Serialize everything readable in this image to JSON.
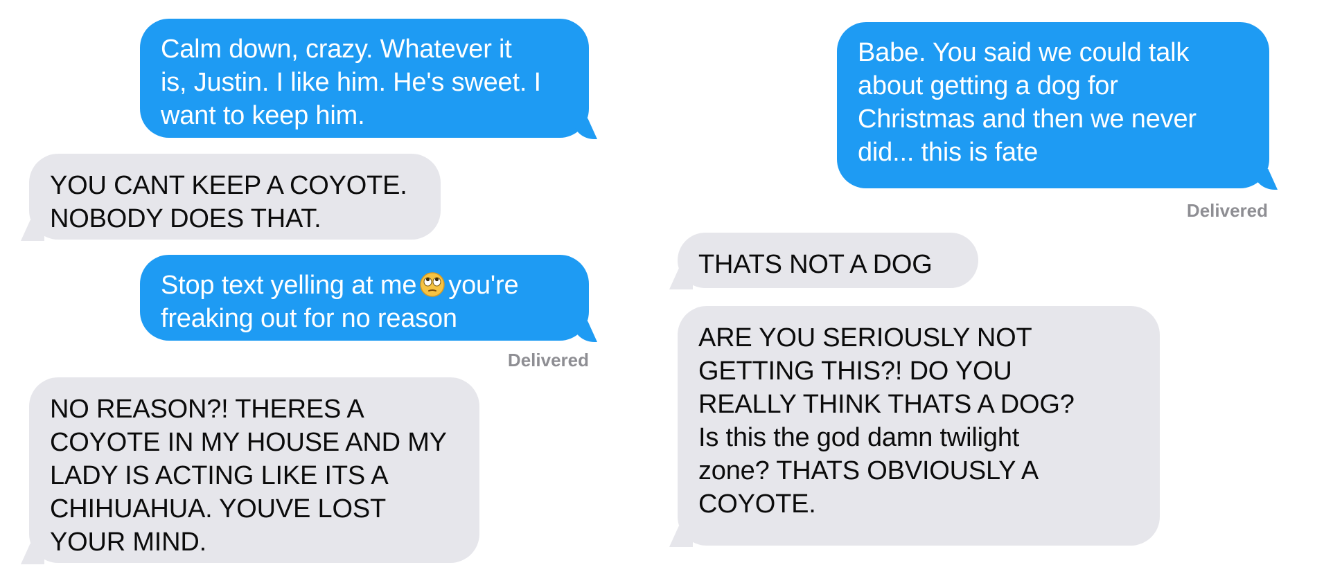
{
  "left_conversation": {
    "messages": [
      {
        "side": "sent",
        "text": "Calm down, crazy. Whatever it\nis, Justin. I like him. He's sweet. I\nwant to keep him."
      },
      {
        "side": "received",
        "text": "YOU CANT KEEP A COYOTE.\nNOBODY DOES THAT."
      },
      {
        "side": "sent",
        "text_before_emoji": "Stop text yelling at me",
        "emoji": "eye-roll-emoji",
        "text_after_emoji": "you're",
        "text_line2": "freaking out for no reason"
      },
      {
        "side": "received",
        "text": "NO REASON?! THERES A\nCOYOTE IN MY HOUSE AND MY\nLADY IS ACTING LIKE ITS A\nCHIHUAHUA. YOUVE LOST\nYOUR MIND."
      }
    ],
    "delivered_label": "Delivered"
  },
  "right_conversation": {
    "messages": [
      {
        "side": "sent",
        "text": "Babe. You said we could talk\nabout getting a dog for\nChristmas and then we never\ndid... this is fate"
      },
      {
        "side": "received",
        "text": "THATS NOT A DOG"
      },
      {
        "side": "received",
        "text": "ARE YOU SERIOUSLY NOT\nGETTING THIS?! DO YOU\nREALLY THINK THATS A DOG?\nIs this the god damn twilight\nzone? THATS OBVIOUSLY A\nCOYOTE."
      }
    ],
    "delivered_label": "Delivered"
  },
  "colors": {
    "sent_bubble": "#1e9bf3",
    "received_bubble": "#e6e6eb",
    "delivered_text": "#8e8e93"
  }
}
